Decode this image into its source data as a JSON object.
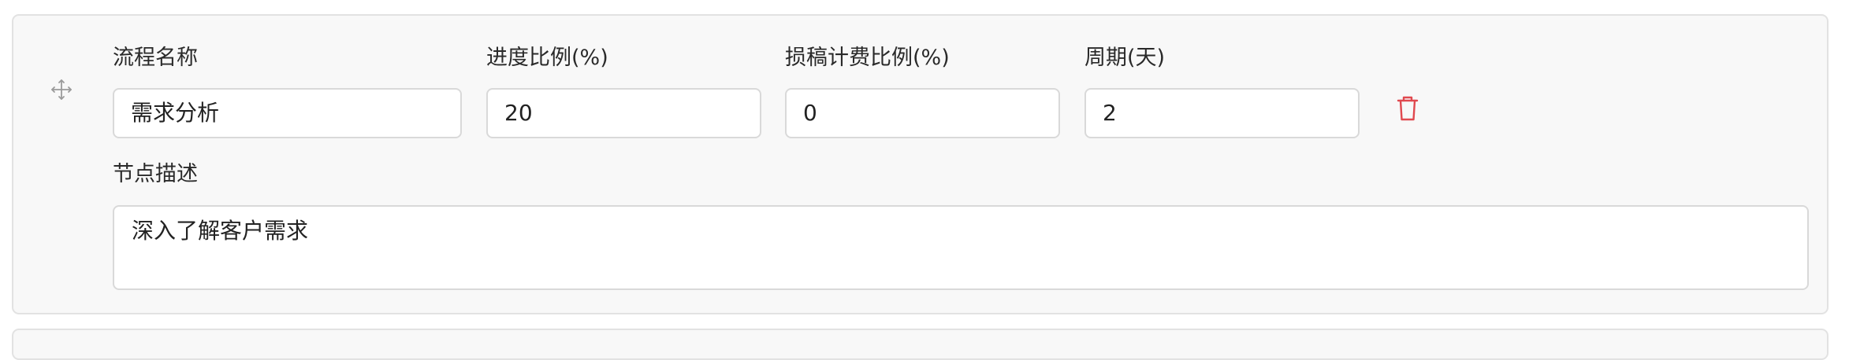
{
  "stage_form": {
    "fields": {
      "name": {
        "label": "流程名称",
        "value": "需求分析"
      },
      "progress_ratio": {
        "label": "进度比例(%)",
        "value": "20"
      },
      "cancel_fee_ratio": {
        "label": "损稿计费比例(%)",
        "value": "0"
      },
      "period_days": {
        "label": "周期(天)",
        "value": "2"
      },
      "description": {
        "label": "节点描述",
        "value": "深入了解客户需求"
      }
    },
    "icons": {
      "drag": "move-icon",
      "delete": "trash-icon"
    },
    "colors": {
      "delete_icon": "#e0494f",
      "drag_icon": "#9a9a9a",
      "card_background": "#f8f8f8",
      "border": "#d9d9d9"
    }
  }
}
